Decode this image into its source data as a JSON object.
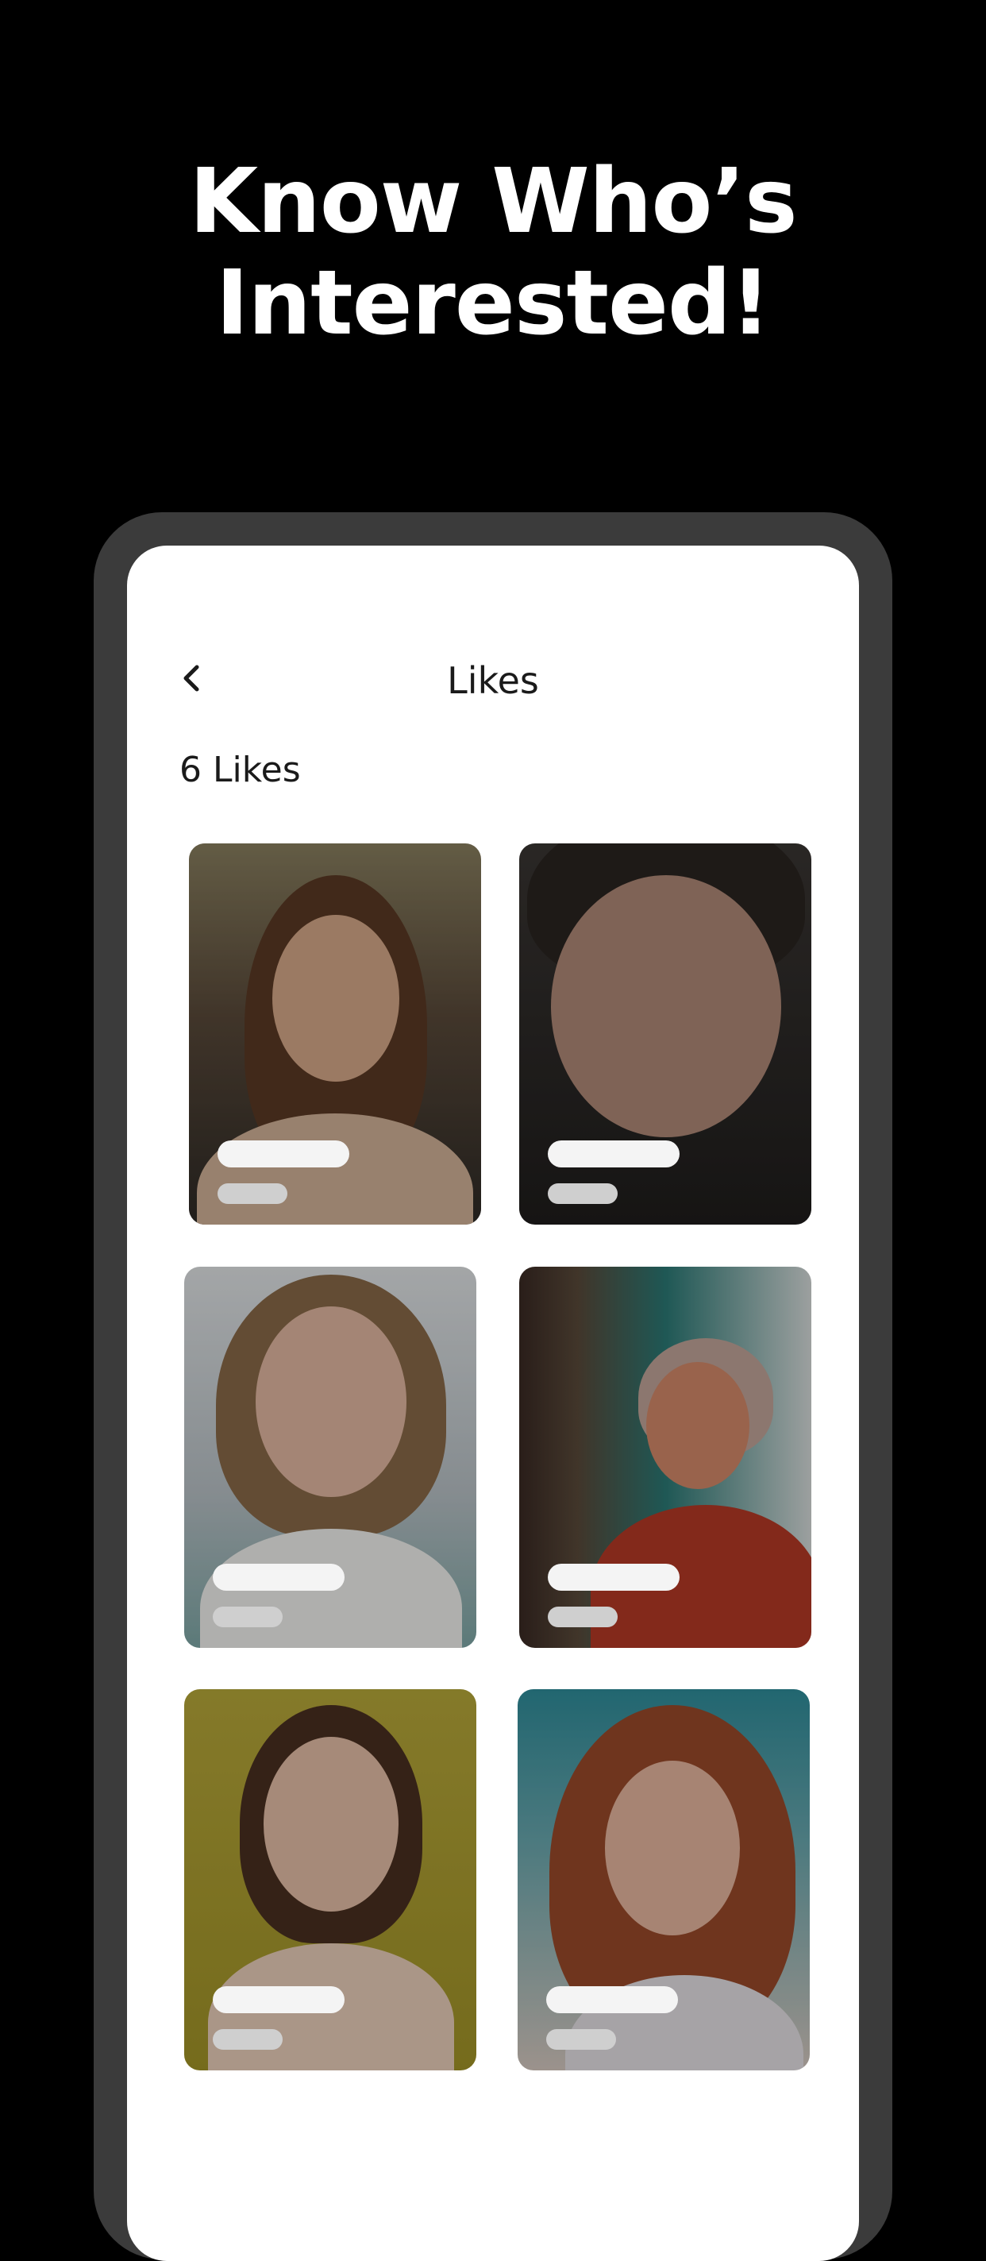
{
  "headline": {
    "line1": "Know Who’s",
    "line2": "Interested!"
  },
  "header": {
    "title": "Likes",
    "back_icon": "chevron-left-icon"
  },
  "likes": {
    "count_label": "6 Likes"
  },
  "cards": [
    {
      "bg": "#6b5a4a",
      "bg2": "#8c7a60"
    },
    {
      "bg": "#2f2c2a",
      "bg2": "#4a4541"
    },
    {
      "bg": "#c9ced3",
      "bg2": "#a9b4bb"
    },
    {
      "bg": "#2a6b69",
      "bg2": "#b64a32"
    },
    {
      "bg": "#a89a2a",
      "bg2": "#c4b43a"
    },
    {
      "bg": "#3d8a96",
      "bg2": "#c8b9b0"
    }
  ]
}
